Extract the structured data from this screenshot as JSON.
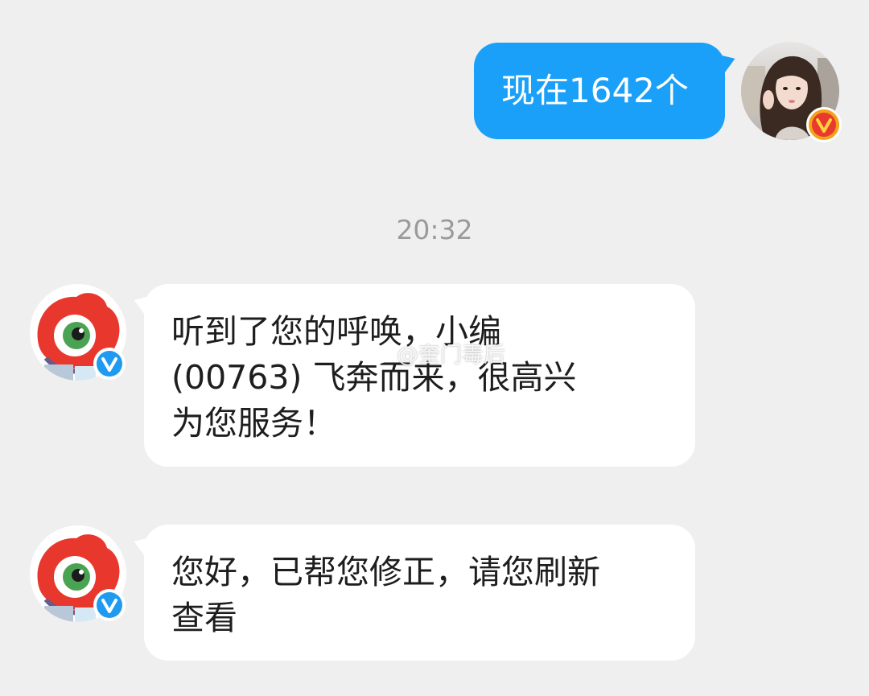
{
  "conversation": {
    "sent_messages": [
      {
        "text": "现在1642个"
      }
    ],
    "timestamp": "20:32",
    "received_messages": [
      {
        "lines": [
          "听到了您的呼唤，小编",
          "(00763) 飞奔而来，很高兴",
          "为您服务！"
        ]
      },
      {
        "lines": [
          "您好，已帮您修正，请您刷新",
          "查看"
        ]
      }
    ]
  },
  "watermark": {
    "text": "@奎门毒后"
  },
  "icons": {
    "user_badge": "vip-v-badge-icon",
    "bot_badge": "verified-v-badge-icon",
    "watermark_logo": "weibo-logo-icon"
  },
  "colors": {
    "background": "#efefef",
    "sent_bubble": "#1aa0f8",
    "received_bubble": "#ffffff",
    "timestamp": "#9a9a9a",
    "vip_badge": "#f4a21a",
    "verified_badge": "#1e9bf0"
  }
}
